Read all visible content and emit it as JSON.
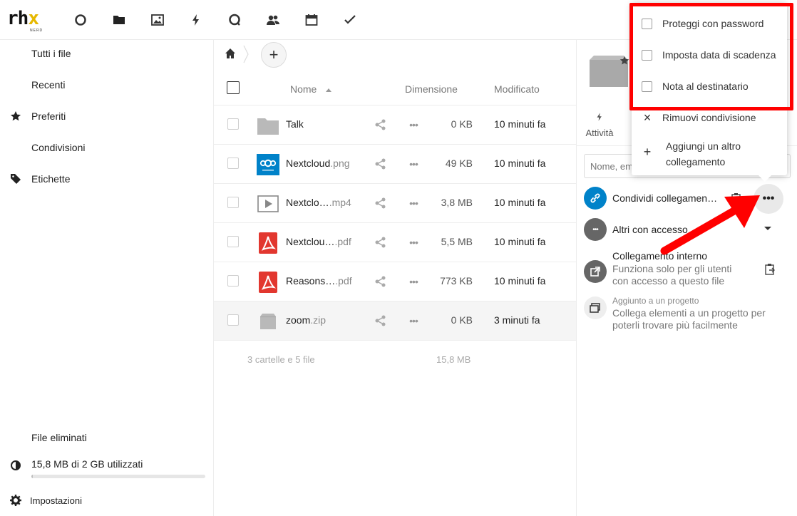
{
  "header": {
    "logo_text": "rhx",
    "logo_subtext": "NERD",
    "nav": [
      {
        "name": "dashboard-icon"
      },
      {
        "name": "files-icon"
      },
      {
        "name": "photos-icon"
      },
      {
        "name": "activity-icon"
      },
      {
        "name": "talk-icon"
      },
      {
        "name": "contacts-icon"
      },
      {
        "name": "calendar-icon"
      },
      {
        "name": "tasks-icon"
      }
    ]
  },
  "sidebar": {
    "items": [
      {
        "label": "Tutti i file"
      },
      {
        "label": "Recenti"
      },
      {
        "label": "Preferiti",
        "icon": "star-icon"
      },
      {
        "label": "Condivisioni"
      },
      {
        "label": "Etichette",
        "icon": "tag-icon"
      }
    ],
    "deleted": "File eliminati",
    "quota_label": "15,8 MB di 2 GB utilizzati",
    "quota_used_fraction": 0.008,
    "settings": "Impostazioni"
  },
  "filelist": {
    "columns": {
      "name": "Nome",
      "size": "Dimensione",
      "modified": "Modificato"
    },
    "rows": [
      {
        "name": "Talk",
        "ext": "",
        "size": "0 KB",
        "modified": "10 minuti fa",
        "type": "folder"
      },
      {
        "name": "Nextcloud",
        "ext": ".png",
        "size": "49 KB",
        "modified": "10 minuti fa",
        "type": "image"
      },
      {
        "name": "Nextclo…",
        "ext": ".mp4",
        "size": "3,8 MB",
        "modified": "10 minuti fa",
        "type": "video"
      },
      {
        "name": "Nextclou…",
        "ext": ".pdf",
        "size": "5,5 MB",
        "modified": "10 minuti fa",
        "type": "pdf"
      },
      {
        "name": "Reasons…",
        "ext": ".pdf",
        "size": "773 KB",
        "modified": "10 minuti fa",
        "type": "pdf"
      },
      {
        "name": "zoom",
        "ext": ".zip",
        "size": "0 KB",
        "modified": "3 minuti fa",
        "type": "archive"
      }
    ],
    "summary_count": "3 cartelle e 5 file",
    "summary_size": "15,8 MB"
  },
  "panel": {
    "activity_tab": "Attività",
    "search_placeholder": "Nome, em",
    "share_link": "Condividi collegamen…",
    "others_access": "Altri con accesso",
    "internal_link_title": "Collegamento interno",
    "internal_link_sub": "Funziona solo per gli utenti con accesso a questo file",
    "project_title": "Aggiunto a un progetto",
    "project_sub": "Collega elementi a un progetto per poterli trovare più facilmente",
    "dots": "•••"
  },
  "popover": {
    "items": [
      {
        "label": "Proteggi con password",
        "kind": "checkbox"
      },
      {
        "label": "Imposta data di scadenza",
        "kind": "checkbox"
      },
      {
        "label": "Nota al destinatario",
        "kind": "checkbox"
      },
      {
        "label": "Rimuovi condivisione",
        "kind": "action",
        "icon": "×"
      },
      {
        "label1": "Aggiungi un altro",
        "label2": "collegamento",
        "kind": "action",
        "icon": "+"
      }
    ]
  },
  "colors": {
    "accent": "#0082c9",
    "highlight": "#ff0000",
    "pdf": "#e2372f"
  }
}
